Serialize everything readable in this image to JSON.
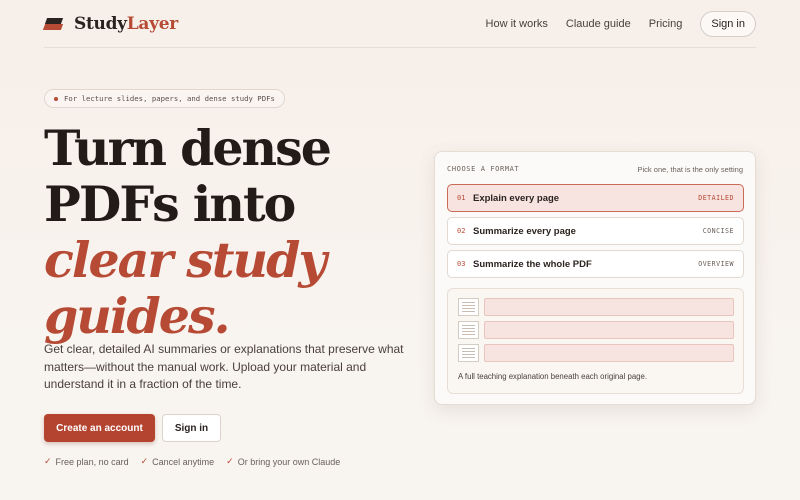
{
  "brand": {
    "name_part1": "Study",
    "name_part2": "Layer",
    "accent": "#b64a35"
  },
  "nav": {
    "links": [
      "How it works",
      "Claude guide",
      "Pricing"
    ],
    "signin": "Sign in"
  },
  "hero": {
    "pill": "For lecture slides, papers, and dense study PDFs",
    "headline_line1": "Turn dense",
    "headline_line2": "PDFs into",
    "headline_accent1": "clear study",
    "headline_accent2": "guides.",
    "description": "Get clear, detailed AI summaries or explanations that preserve what matters—without the manual work. Upload your material and understand it in a fraction of the time.",
    "cta_primary": "Create an account",
    "cta_secondary": "Sign in",
    "perks": [
      "Free plan, no card",
      "Cancel anytime",
      "Or bring your own Claude"
    ]
  },
  "card": {
    "label": "CHOOSE A FORMAT",
    "hint": "Pick one, that is the only setting",
    "options": [
      {
        "num": "01",
        "label": "Explain every page",
        "tag": "DETAILED",
        "selected": true
      },
      {
        "num": "02",
        "label": "Summarize every page",
        "tag": "CONCISE",
        "selected": false
      },
      {
        "num": "03",
        "label": "Summarize the whole PDF",
        "tag": "OVERVIEW",
        "selected": false
      }
    ],
    "preview_caption": "A full teaching explanation beneath each original page."
  }
}
